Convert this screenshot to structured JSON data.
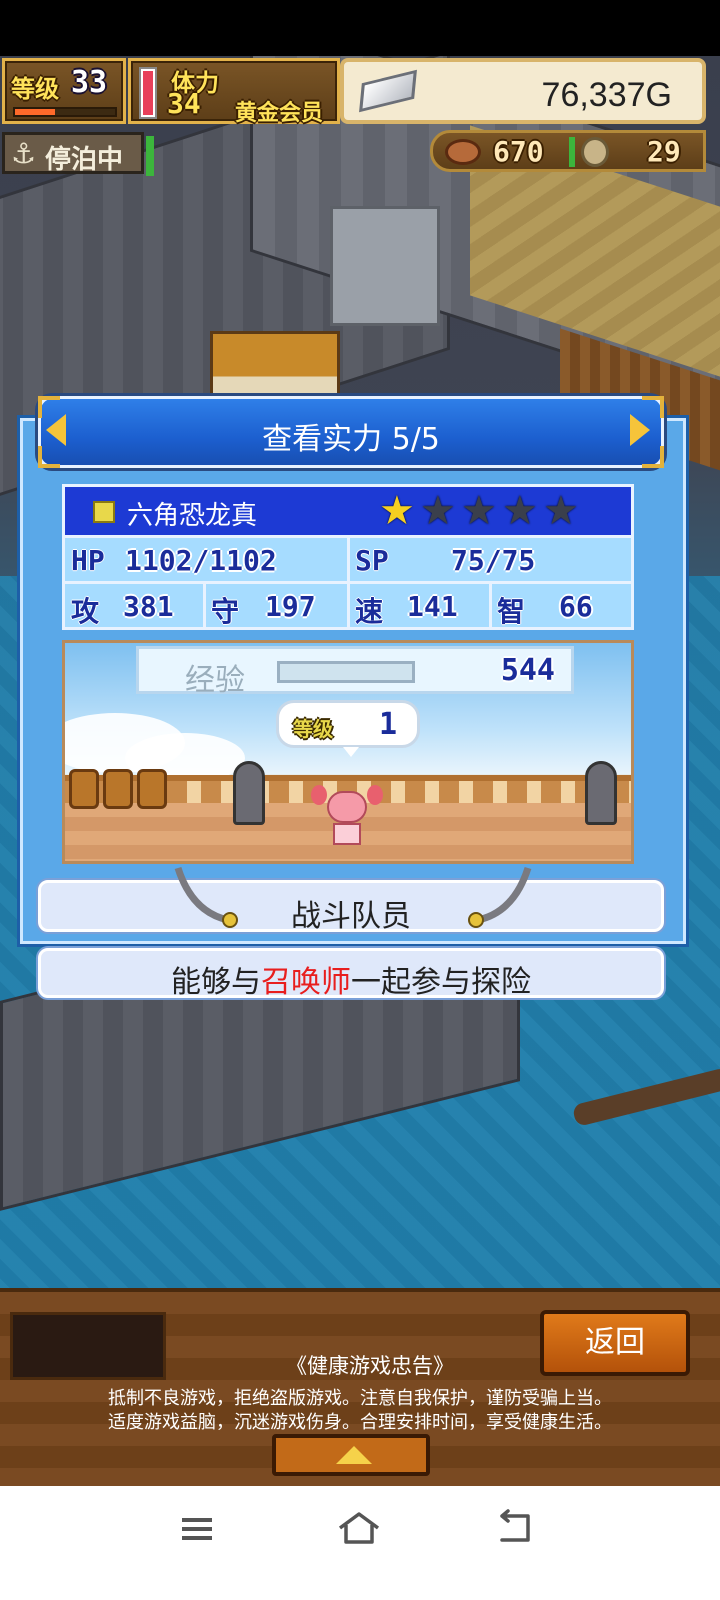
{
  "hud": {
    "level_label": "等级",
    "level_value": "33",
    "level_progress": 0.4,
    "stamina_label": "体力",
    "stamina_value": "34",
    "membership": "黄金会员",
    "gold": "76,337G",
    "anchor_status": "停泊中",
    "food": "670",
    "medals": "29"
  },
  "dialog": {
    "title": "查看实力 5/5",
    "unit_name": "六角恐龙真",
    "stars_total": 5,
    "stars_filled": 1,
    "stats": {
      "hp_label": "HP",
      "hp_value": "1102/1102",
      "sp_label": "SP",
      "sp_value": "75/75",
      "atk_label": "攻",
      "atk_value": "381",
      "def_label": "守",
      "def_value": "197",
      "spd_label": "速",
      "spd_value": "141",
      "int_label": "智",
      "int_value": "66"
    },
    "exp_label": "经验",
    "exp_value": "544",
    "exp_progress": 0.0,
    "level_label": "等级",
    "level_value": "1",
    "role": "战斗队员",
    "description_pre": "能够与",
    "description_highlight": "召唤师",
    "description_post": "一起参与探险"
  },
  "bottom": {
    "back_label": "返回",
    "advice_title": "《健康游戏忠告》",
    "advice_line1": "抵制不良游戏，拒绝盗版游戏。注意自我保护，谨防受骗上当。",
    "advice_line2": "适度游戏益脑，沉迷游戏伤身。合理安排时间，享受健康生活。"
  },
  "colors": {
    "accent_blue": "#1c5fcf",
    "star_gold": "#f6d020",
    "highlight_red": "#e81e1e",
    "button_orange": "#e07a1a"
  },
  "icons": [
    "silver-ingot-icon",
    "anchor-icon",
    "meat-icon",
    "medal-icon",
    "star-icon",
    "sword-icon",
    "menu-icon",
    "home-icon",
    "back-icon"
  ]
}
